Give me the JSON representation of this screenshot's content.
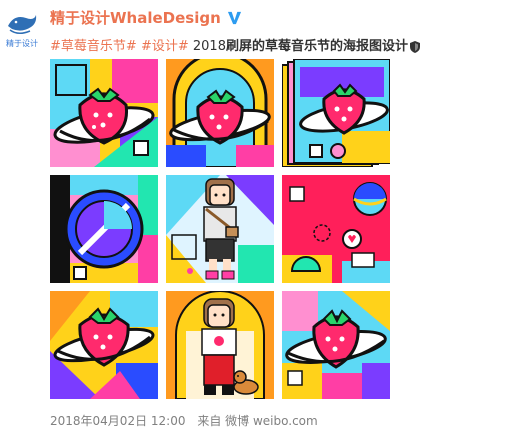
{
  "user": {
    "name": "精于设计WhaleDesign",
    "avatar_caption": "精于设计",
    "verified_color": "#2d9cf0"
  },
  "post": {
    "tag_1": "#草莓音乐节#",
    "tag_2": "#设计#",
    "text_year": "2018",
    "text_bold": "刷屏的草莓音乐节的海报图设计"
  },
  "images": [
    {
      "name": "strawberry-planet-poster-1"
    },
    {
      "name": "strawberry-planet-poster-2"
    },
    {
      "name": "strawberry-planet-poster-stack"
    },
    {
      "name": "geometric-circle-poster"
    },
    {
      "name": "girl-with-bag-poster"
    },
    {
      "name": "geometric-shapes-poster"
    },
    {
      "name": "strawberry-planet-poster-3"
    },
    {
      "name": "girl-with-dog-poster"
    },
    {
      "name": "strawberry-planet-poster-4"
    }
  ],
  "footer": {
    "timestamp": "2018年04月02日 12:00",
    "source_prefix": "来自",
    "source_app": "微博 weibo.com"
  },
  "colors": {
    "accent": "#eb7350",
    "meta_text": "#808080"
  }
}
